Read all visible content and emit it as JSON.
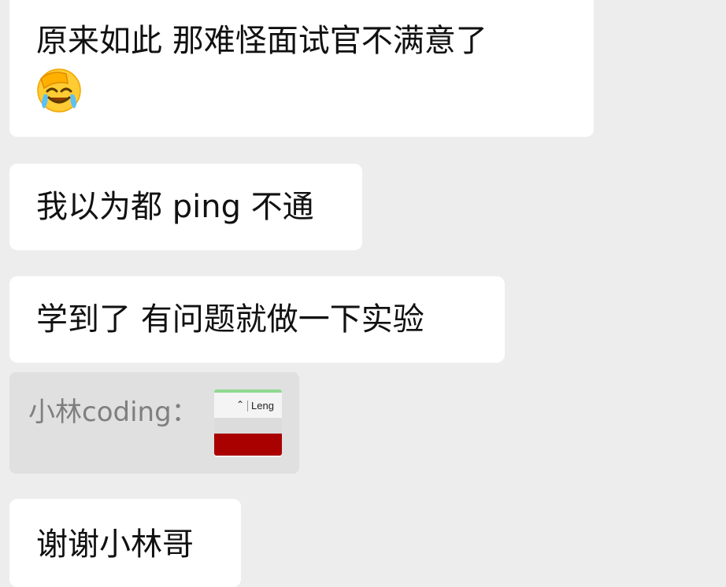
{
  "messages": [
    {
      "text": "原来如此 那难怪面试官不满意了",
      "emoji": "face-palm-tears-emoji"
    },
    {
      "text": "我以为都 ping 不通"
    },
    {
      "text": "学到了 有问题就做一下实验"
    },
    {
      "text": "谢谢小林哥"
    }
  ],
  "quoted": {
    "sender": "小林coding：",
    "thumbnail_label": "Leng"
  },
  "colors": {
    "background": "#ededed",
    "bubble": "#ffffff",
    "quote_bg": "#e0e0e0",
    "thumb_red": "#a90000"
  }
}
